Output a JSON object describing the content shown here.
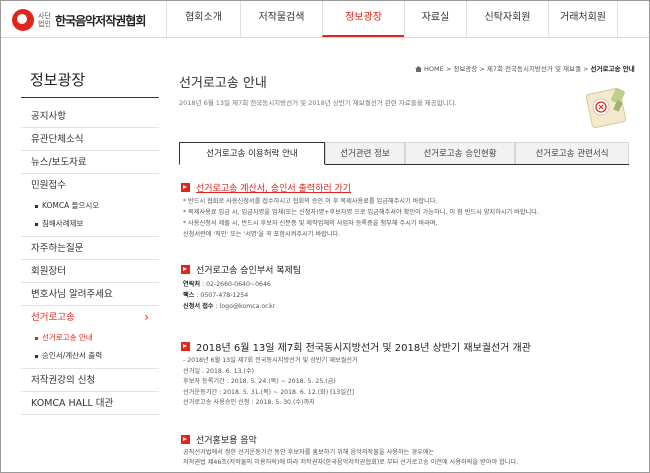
{
  "logo": {
    "sub": "사단법인",
    "name": "한국음악저작권협회"
  },
  "gnb": [
    {
      "label": "협회소개",
      "width": 0
    },
    {
      "label": "저작물검색"
    },
    {
      "label": "정보광장",
      "active": true
    },
    {
      "label": "자료실"
    },
    {
      "label": "신탁자회원"
    },
    {
      "label": "거래처회원"
    }
  ],
  "sidebar": {
    "title": "정보광장",
    "items": [
      {
        "label": "공지사항"
      },
      {
        "label": "유관단체소식"
      },
      {
        "label": "뉴스/보도자료"
      },
      {
        "label": "민원접수"
      },
      {
        "label": "KOMCA 들으시오",
        "sub": true
      },
      {
        "label": "침해사례제보",
        "sub": true
      },
      {
        "label": "자주하는질문"
      },
      {
        "label": "회원장터"
      },
      {
        "label": "변호사님 알려주세요"
      },
      {
        "label": "선거로고송",
        "active": true
      },
      {
        "label": "선거로고송 안내",
        "sub": true,
        "active": true
      },
      {
        "label": "승인서/계산서 출력",
        "sub": true
      },
      {
        "label": "저작권강의 신청"
      },
      {
        "label": "KOMCA HALL 대관"
      }
    ]
  },
  "breadcrumb": {
    "home": "HOME",
    "sep": ">",
    "path1": "정보광장",
    "path2": "제7회 전국동시지방선거 및 재보궐",
    "current": "선거로고송 안내"
  },
  "page": {
    "title": "선거로고송 안내",
    "desc": "2018년 6월 13일 제7회 전국동시지방선거 및 2018년 상반기 재보궐선거 관련 자료들을 제공합니다."
  },
  "tabs": [
    "선거로고송 이용허락 안내",
    "선거관련 정보",
    "선거로고송 승인현황",
    "선거로고송 관련서식"
  ],
  "sections": {
    "print_link": "선거로고송 계산서, 승인서 출력하러 가기",
    "notes": [
      "* 반드시 협회로 사용신청서를 접수하시고 협회의 승인 이 후 복제사용료를 입금해주시기 바랍니다.",
      "* 복제사용료 입금 시, 입금자명을 업체(또는 신청자)명+후보자명 으로 입금해주셔야 확인이 가능하니, 이 점 반드시 양지하시기 바랍니다.",
      "* 사용신청서 제출 시, 반드시 후보자 신분증 및 제작업체의 사업자 등록증을 첨부해 주시기 바라며,",
      "   신청서란에 '직인' 또는 '서명'을 꼭 포함시켜주시기 바랍니다."
    ],
    "contact_title": "선거로고송 승인부서 복제팀",
    "contact": [
      {
        "k": "연락처",
        "v": " : 02-2660-0640~0646"
      },
      {
        "k": "팩스",
        "v": " : 0507-478-1254"
      },
      {
        "k": "신청서 접수",
        "v": " : logo@komca.or.kr"
      }
    ],
    "election_title": "2018년 6월 13일 제7회 전국동시지방선거 및 2018년 상반기 재보궐선거 개관",
    "election": [
      "- 2018년 6월 13일 제7회 전국동시지방선거 및 상반기 재보궐선거",
      "선거일 : 2018. 6. 13.(수)",
      "후보자 등록기간 : 2018. 5. 24.(목) ~ 2018. 5. 25.(금)",
      "선거운동기간 : 2018. 5. 31.(목) ~ 2018. 6. 12.(화) [13일간]",
      "선거로고송 사용승인 신청 : 2018. 5. 30.(수)까지"
    ],
    "music_title": "선거홍보용 음악",
    "music": [
      "공직선거법에서 정한 선거운동기간 동안 후보자를 홍보하기 위해 음악저작물을 사용하는 경우에는",
      "저작권법 제46조(저작물의 이용허락)에 따라 저작권자(한국음악저작권협회)로 부터 선거로고송 이전에 사용허락을 받아야 합니다."
    ]
  }
}
